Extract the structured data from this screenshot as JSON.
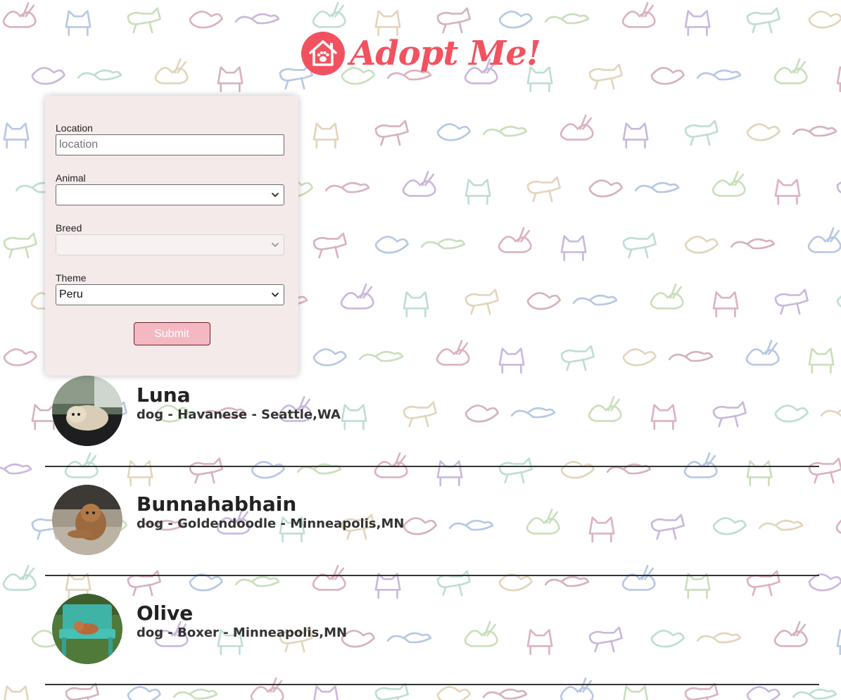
{
  "app": {
    "title": "Adopt Me!",
    "brand_color": "#f2525f"
  },
  "search": {
    "location_label": "Location",
    "location_placeholder": "location",
    "location_value": "",
    "animal_label": "Animal",
    "animal_value": "",
    "breed_label": "Breed",
    "breed_value": "",
    "breed_disabled": true,
    "theme_label": "Theme",
    "theme_value": "Peru",
    "submit_label": "Submit",
    "submit_color": "#f4b8c2"
  },
  "pets": [
    {
      "name": "Luna",
      "description": "dog - Havanese - Seattle,WA"
    },
    {
      "name": "Bunnahabhain",
      "description": "dog - Goldendoodle - Minneapolis,MN"
    },
    {
      "name": "Olive",
      "description": "dog - Boxer - Minneapolis,MN"
    }
  ],
  "icons": {
    "logo": "house-paw-icon",
    "select_arrow": "chevron-down-icon"
  }
}
